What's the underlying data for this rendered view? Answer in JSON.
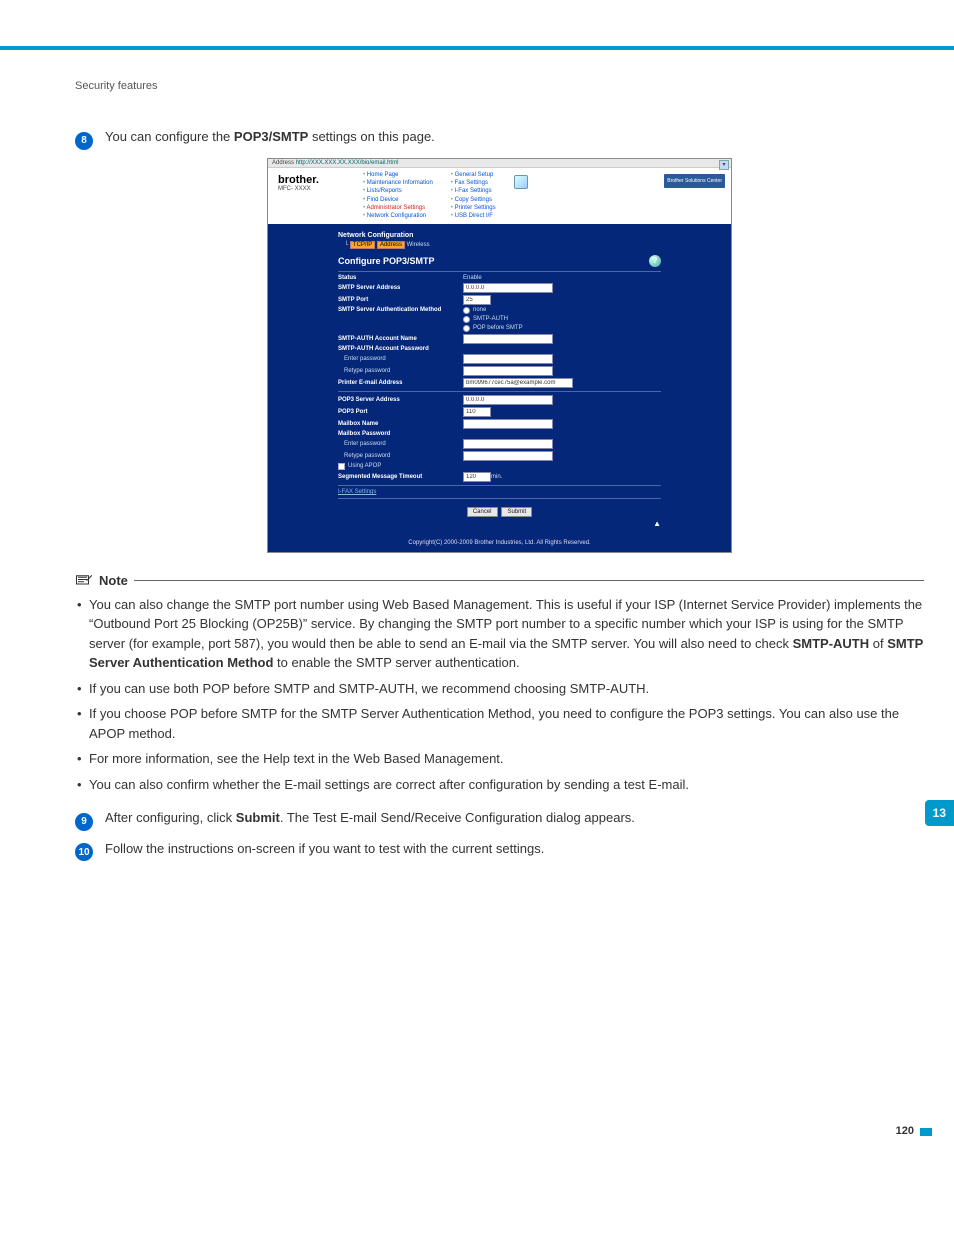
{
  "header": {
    "section": "Security features"
  },
  "steps": {
    "s8_num": "8",
    "s8_pre": "You can configure the ",
    "s8_bold": "POP3/SMTP",
    "s8_post": " settings on this page.",
    "s9_num": "9",
    "s9_pre": "After configuring, click ",
    "s9_bold": "Submit",
    "s9_post": ". The Test E-mail Send/Receive Configuration dialog appears.",
    "s10_num": "10",
    "s10_text": "Follow the instructions on-screen if you want to test with the current settings."
  },
  "note": {
    "label": "Note",
    "b1a": "You can also change the SMTP port number using Web Based Management. This is useful if your ISP (Internet Service Provider) implements the “Outbound Port 25 Blocking (OP25B)” service. By changing the SMTP port number to a specific number which your ISP is using for the SMTP server (for example, port 587), you would then be able to send an E-mail via the SMTP server. You will also need to check ",
    "b1b": "SMTP-AUTH",
    "b1c": " of ",
    "b1d": "SMTP Server Authentication Method",
    "b1e": " to enable the SMTP server authentication.",
    "b2": "If you can use both POP before SMTP and SMTP-AUTH, we recommend choosing SMTP-AUTH.",
    "b3": "If you choose POP before SMTP for the SMTP Server Authentication Method, you need to configure the POP3 settings. You can also use the APOP method.",
    "b4": "For more information, see the Help text in the Web Based Management.",
    "b5": "You can also confirm whether the E-mail settings are correct after configuration by sending a test E-mail."
  },
  "wbm": {
    "address_label": "Address",
    "address_url": "http://XXX.XXX.XX.XXX/bio/email.html",
    "brand": "brother.",
    "model": "MFC- XXXX",
    "links_col1": [
      "Home Page",
      "Maintenance Information",
      "Lists/Reports",
      "Find Device",
      "Administrator Settings",
      "Network Configuration"
    ],
    "links_col2": [
      "General Setup",
      "Fax Settings",
      "I-Fax Settings",
      "Copy Settings",
      "Printer Settings",
      "USB Direct I/F"
    ],
    "bsc": "Brother Solutions Center",
    "nc_title": "Network Configuration",
    "tree_label": "TCP/IP",
    "tree_sub": "Address",
    "tree_end": "Wireless",
    "panel_title": "Configure POP3/SMTP",
    "fields": {
      "status_lbl": "Status",
      "status_val": "Enable",
      "smtp_addr_lbl": "SMTP Server Address",
      "smtp_addr_val": "0.0.0.0",
      "smtp_port_lbl": "SMTP Port",
      "smtp_port_val": "25",
      "auth_lbl": "SMTP Server Authentication Method",
      "auth_none": "none",
      "auth_smtp": "SMTP-AUTH",
      "auth_pop": "POP before SMTP",
      "acct_name_lbl": "SMTP-AUTH Account Name",
      "acct_pass_lbl": "SMTP-AUTH Account Password",
      "enter_pass_lbl": "Enter password",
      "retype_pass_lbl": "Retype password",
      "printer_email_lbl": "Printer E-mail Address",
      "printer_email_val": "bm099677cec75a@example.com",
      "pop_addr_lbl": "POP3 Server Address",
      "pop_addr_val": "0.0.0.0",
      "pop_port_lbl": "POP3 Port",
      "pop_port_val": "110",
      "mbox_name_lbl": "Mailbox Name",
      "mbox_pass_lbl": "Mailbox Password",
      "apop_lbl": "Using APOP",
      "timeout_lbl": "Segmented Message Timeout",
      "timeout_val": "120",
      "timeout_unit": "min.",
      "ifax_link": "I-FAX Settings"
    },
    "btn_cancel": "Cancel",
    "btn_submit": "Submit",
    "copyright": "Copyright(C) 2000-2009 Brother Industries, Ltd. All Rights Reserved."
  },
  "chapter": "13",
  "page": "120"
}
